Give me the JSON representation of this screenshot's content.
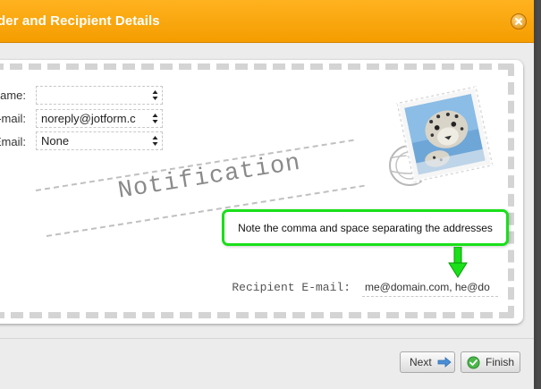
{
  "dialog": {
    "title": "der and Recipient Details",
    "close_icon": "close-icon"
  },
  "form": {
    "sender_name": {
      "label": "ame:",
      "value": ""
    },
    "sender_email": {
      "label": "-mail:",
      "value": "noreply@jotform.c"
    },
    "reply_email": {
      "label": "Email:",
      "value": "None"
    }
  },
  "stamp": {
    "icon": "mail-stamp-leopard-icon"
  },
  "notification_text": "Notification",
  "callout": {
    "text": "Note the comma and space separating the addresses",
    "border_color": "#19e019"
  },
  "recipient": {
    "label": "Recipient E-mail:",
    "value": "me@domain.com, he@do"
  },
  "footer": {
    "next_label": "Next",
    "next_icon": "arrow-right-icon",
    "finish_label": "Finish",
    "finish_icon": "check-circle-icon"
  },
  "colors": {
    "titlebar": "#f49d00",
    "accent_green": "#19e019"
  }
}
